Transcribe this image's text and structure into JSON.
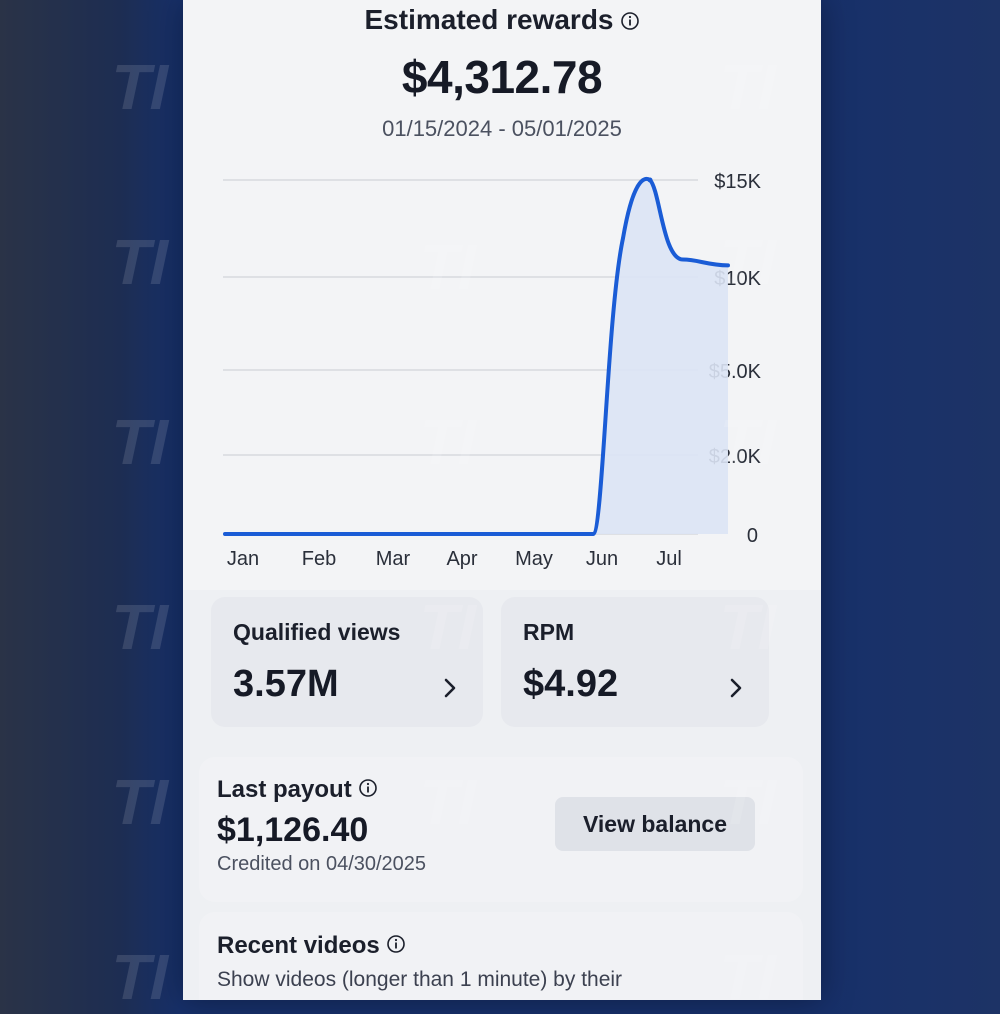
{
  "header": {
    "title": "Estimated rewards",
    "amount": "$4,312.78",
    "date_range": "01/15/2024 - 05/01/2025"
  },
  "chart_data": {
    "type": "line",
    "x": [
      "Jan",
      "Feb",
      "Mar",
      "Apr",
      "May",
      "Jun",
      "Jul"
    ],
    "y_ticks": [
      "0",
      "$2.0K",
      "$5.0K",
      "$10K",
      "$15K"
    ],
    "series": [
      {
        "values": [
          [
            "Jan",
            0
          ],
          [
            "Feb",
            0
          ],
          [
            "Mar",
            0
          ],
          [
            "Apr",
            0
          ],
          [
            "May",
            0
          ],
          [
            "Jun",
            0
          ],
          [
            "Jun",
            6000
          ],
          [
            "Jul",
            15000
          ],
          [
            "Jul",
            11000
          ],
          [
            "Jul",
            10500
          ]
        ]
      }
    ],
    "grid": true,
    "y_axis_position": "right"
  },
  "metrics": [
    {
      "label": "Qualified views",
      "value": "3.57M"
    },
    {
      "label": "RPM",
      "value": "$4.92"
    }
  ],
  "payout": {
    "title": "Last payout",
    "amount": "$1,126.40",
    "credited": "Credited on 04/30/2025",
    "button_label": "View balance"
  },
  "recent": {
    "title": "Recent videos",
    "description": "Show videos (longer than 1 minute) by their"
  },
  "watermark_text": "TI",
  "colors": {
    "accent": "#1a5cd6",
    "fill": "#dbe4f5"
  }
}
